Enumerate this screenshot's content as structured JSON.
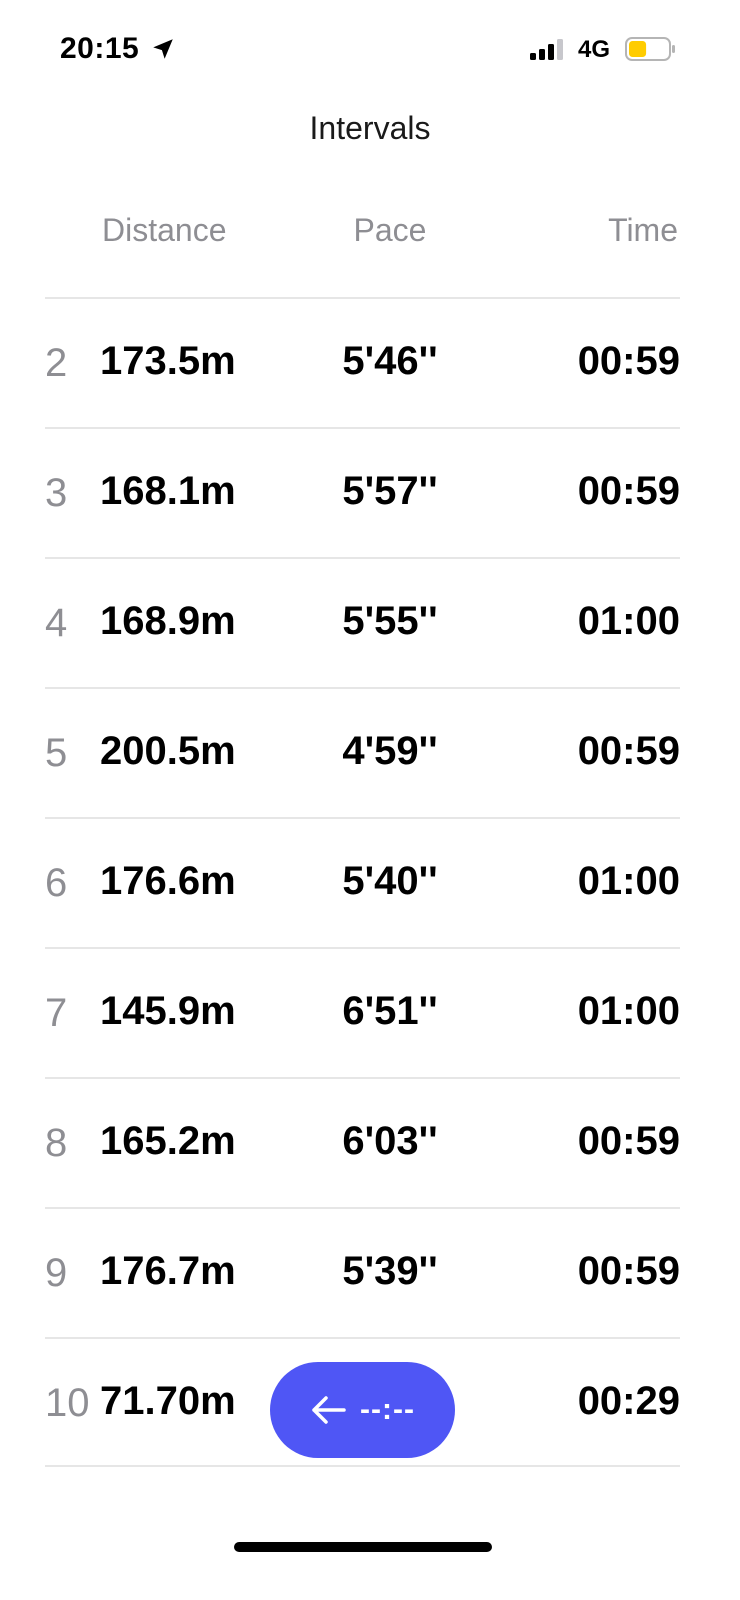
{
  "status_bar": {
    "time": "20:15",
    "network": "4G",
    "location_icon": "location-arrow-icon",
    "signal_icon": "cellular-signal-icon",
    "battery_icon": "battery-icon",
    "battery_color": "#ffcc00",
    "battery_level": 0.45
  },
  "page": {
    "title": "Intervals"
  },
  "table": {
    "headers": {
      "distance": "Distance",
      "pace": "Pace",
      "time": "Time"
    },
    "rows": [
      {
        "index": "2",
        "distance": "173.5m",
        "pace": "5'46''",
        "time": "00:59"
      },
      {
        "index": "3",
        "distance": "168.1m",
        "pace": "5'57''",
        "time": "00:59"
      },
      {
        "index": "4",
        "distance": "168.9m",
        "pace": "5'55''",
        "time": "01:00"
      },
      {
        "index": "5",
        "distance": "200.5m",
        "pace": "4'59''",
        "time": "00:59"
      },
      {
        "index": "6",
        "distance": "176.6m",
        "pace": "5'40''",
        "time": "01:00"
      },
      {
        "index": "7",
        "distance": "145.9m",
        "pace": "6'51''",
        "time": "01:00"
      },
      {
        "index": "8",
        "distance": "165.2m",
        "pace": "6'03''",
        "time": "00:59"
      },
      {
        "index": "9",
        "distance": "176.7m",
        "pace": "5'39''",
        "time": "00:59"
      },
      {
        "index": "10",
        "distance": "71.70m",
        "pace": "",
        "time": "00:29"
      }
    ]
  },
  "floating_button": {
    "label": "--:--",
    "icon": "arrow-left-icon",
    "color": "#4f56f5"
  }
}
